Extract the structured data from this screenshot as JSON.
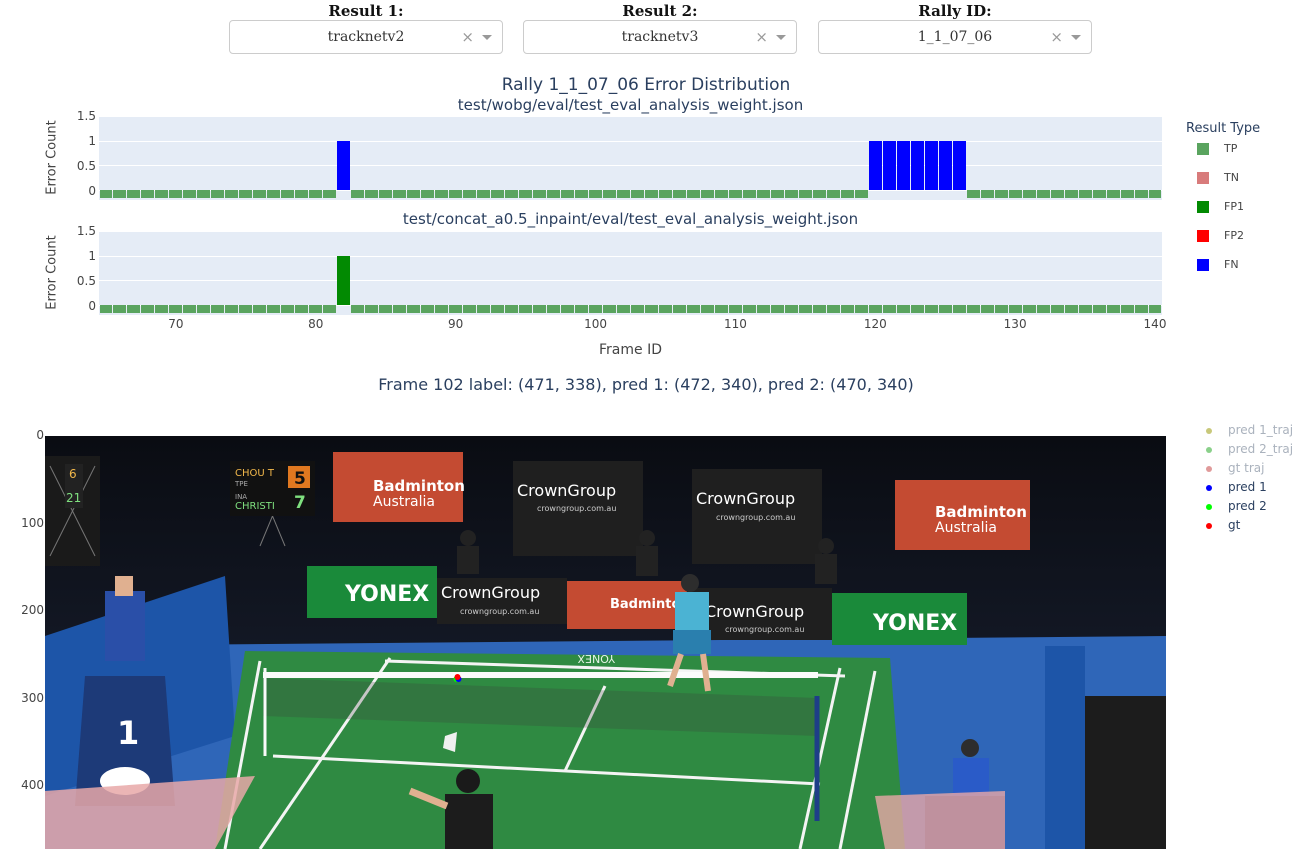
{
  "dropdowns": [
    {
      "label": "Result 1:",
      "value": "tracknetv2",
      "clear": "×"
    },
    {
      "label": "Result 2:",
      "value": "tracknetv3",
      "clear": "×"
    },
    {
      "label": "Rally ID:",
      "value": "1_1_07_06",
      "clear": "×"
    }
  ],
  "figure": {
    "title": "Rally 1_1_07_06 Error Distribution",
    "subplot1_title": "test/wobg/eval/test_eval_analysis_weight.json",
    "subplot2_title": "test/concat_a0.5_inpaint/eval/test_eval_analysis_weight.json",
    "ylabel": "Error Count",
    "xlabel": "Frame ID",
    "yticks": [
      "1.5",
      "1",
      "0.5",
      "0"
    ],
    "xticks": [
      "70",
      "80",
      "90",
      "100",
      "110",
      "120",
      "130",
      "140"
    ]
  },
  "legend": {
    "title": "Result Type",
    "items": [
      {
        "label": "TP",
        "color": "#5aa45f"
      },
      {
        "label": "TN",
        "color": "#d87b7b"
      },
      {
        "label": "FP1",
        "color": "#028a02"
      },
      {
        "label": "FP2",
        "color": "#ff0000"
      },
      {
        "label": "FN",
        "color": "#0000ff"
      }
    ]
  },
  "chart_data": [
    {
      "type": "bar",
      "title": "test/wobg/eval/test_eval_analysis_weight.json",
      "xlabel": "Frame ID",
      "ylabel": "Error Count",
      "xlim": [
        64.5,
        140.5
      ],
      "ylim": [
        -0.2,
        1.5
      ],
      "tp_baseline_value": -0.15,
      "tp_frames_excluded": [
        82,
        120,
        121,
        122,
        123,
        124,
        125,
        126
      ],
      "error_bars": [
        {
          "frame": 82,
          "value": 1,
          "type": "FN"
        },
        {
          "frame": 120,
          "value": 1,
          "type": "FN"
        },
        {
          "frame": 121,
          "value": 1,
          "type": "FN"
        },
        {
          "frame": 122,
          "value": 1,
          "type": "FN"
        },
        {
          "frame": 123,
          "value": 1,
          "type": "FN"
        },
        {
          "frame": 124,
          "value": 1,
          "type": "FN"
        },
        {
          "frame": 125,
          "value": 1,
          "type": "FN"
        },
        {
          "frame": 126,
          "value": 1,
          "type": "FN"
        }
      ]
    },
    {
      "type": "bar",
      "title": "test/concat_a0.5_inpaint/eval/test_eval_analysis_weight.json",
      "xlabel": "Frame ID",
      "ylabel": "Error Count",
      "xlim": [
        64.5,
        140.5
      ],
      "ylim": [
        -0.2,
        1.5
      ],
      "tp_baseline_value": -0.15,
      "tp_frames_excluded": [
        82
      ],
      "error_bars": [
        {
          "frame": 82,
          "value": 1,
          "type": "FP1"
        }
      ]
    }
  ],
  "frame_info": "Frame 102 label: (471, 338), pred 1: (472, 340), pred 2: (470, 340)",
  "image_panel": {
    "yticks": [
      "0",
      "100",
      "200",
      "300",
      "400"
    ],
    "ylim": [
      0,
      470
    ],
    "xlim": [
      0,
      1280
    ],
    "marker_point": {
      "x": 471,
      "y": 338
    },
    "legend": [
      {
        "label": "pred 1_traj",
        "color": "#c8c87a",
        "dim": true
      },
      {
        "label": "pred 2_traj",
        "color": "#8ad08a",
        "dim": true
      },
      {
        "label": "gt traj",
        "color": "#e09a9a",
        "dim": true
      },
      {
        "label": "pred 1",
        "color": "#0000ff",
        "dim": false
      },
      {
        "label": "pred 2",
        "color": "#00ff00",
        "dim": false
      },
      {
        "label": "gt",
        "color": "#ff0000",
        "dim": false
      }
    ],
    "scene": {
      "score_name_1": "CHOU T",
      "score_country_1": "TPE",
      "score_1": "5",
      "score_name_2": "CHRISTI",
      "score_country_2": "INA",
      "score_2": "7",
      "side_score_1": "6",
      "side_score_2": "21",
      "banner_badminton_1": "Badminton",
      "banner_badminton_2": "Australia",
      "banner_crown": "CrownGroup",
      "banner_crown_url": "crowngroup.com.au",
      "banner_yonex": "YONEX",
      "court_yonex": "YONEX",
      "stand_number": "1"
    }
  }
}
